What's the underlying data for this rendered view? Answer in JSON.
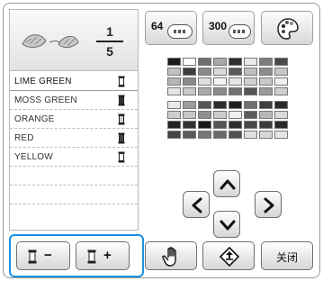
{
  "counter": {
    "current": "1",
    "total": "5"
  },
  "thread_list": [
    {
      "name": "LIME GREEN",
      "selected": true,
      "spool": "dark-outline"
    },
    {
      "name": "MOSS GREEN",
      "selected": false,
      "spool": "dark"
    },
    {
      "name": "ORANGE",
      "selected": false,
      "spool": "light"
    },
    {
      "name": "RED",
      "selected": false,
      "spool": "dark"
    },
    {
      "name": "YELLOW",
      "selected": false,
      "spool": "outline"
    }
  ],
  "tabs": {
    "tab64": "64",
    "tab300": "300"
  },
  "palette_rows": [
    [
      "#1a1a1a",
      "#ffffff",
      "#6e6e6e",
      "#a9a9a9",
      "#2f2f2f",
      "#e8e8e8",
      "#7d7d7d",
      "#4a4a4a"
    ],
    [
      "#c2c2c2",
      "#3d3d3d",
      "#8a8a8a",
      "#d9d9d9",
      "#5a5a5a",
      "#bfbfbf",
      "#8c8c8c",
      "#c8c8c8"
    ],
    [
      "#b5b5b5",
      "#8a8a8a",
      "#dedede",
      "#f4f4f4",
      "#e6e6e6",
      "#d0d0d0",
      "#c9c9c9",
      "#efefef"
    ],
    [
      "#e4e4e4",
      "#cacaca",
      "#ababab",
      "#8b8b8b",
      "#717171",
      "#555555",
      "#9a9a9a",
      "#cfcfcf"
    ],
    [
      "#e9e9e9",
      "#9c9c9c",
      "#565656",
      "#2c2c2c",
      "#1e1e1e",
      "#6f6f6f",
      "#3f3f3f",
      "#2a2a2a"
    ],
    [
      "#cfcfcf",
      "#c6c6c6",
      "#8f8f8f",
      "#cbcbcb",
      "#f0f0f0",
      "#5c5c5c",
      "#b8b8b8",
      "#dadada"
    ],
    [
      "#222222",
      "#333333",
      "#1a1a1a",
      "#555555",
      "#2d2d2d",
      "#474747",
      "#3a3a3a",
      "#292929"
    ],
    [
      "#444444",
      "#5a5a5a",
      "#777777",
      "#6a6a6a",
      "#515151",
      "#e0e0e0",
      "#d8d8d8",
      "#e6e6e6"
    ]
  ],
  "bottom": {
    "minus": "−",
    "plus": "+",
    "close": "关闭"
  },
  "colors": {
    "highlight": "#1a8fe0",
    "border": "#9a9a9a"
  }
}
